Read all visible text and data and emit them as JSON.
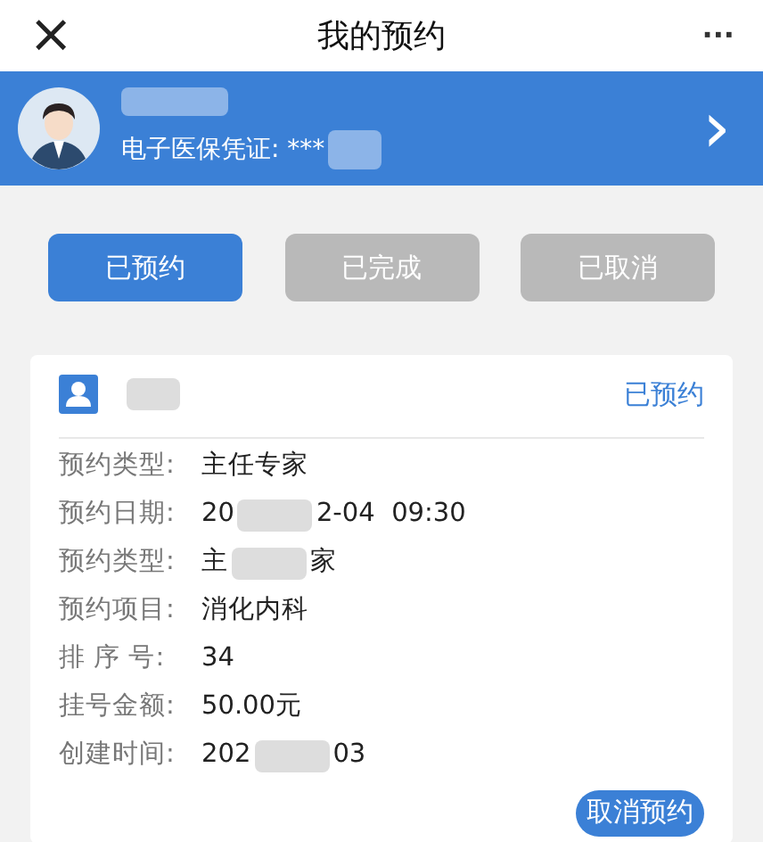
{
  "nav_bar": {
    "close": "×",
    "title": "我的预约",
    "more": "···"
  },
  "profile": {
    "card_label": "电子医保凭证: ***",
    "chevron": "›"
  },
  "tabs": [
    {
      "label": "已预约",
      "selected": true
    },
    {
      "label": "已完成",
      "selected": false
    },
    {
      "label": "已取消",
      "selected": false
    }
  ],
  "appointment": {
    "status": "已预约",
    "fields": [
      {
        "label": "预约类型:",
        "value": "主任专家"
      },
      {
        "label": "预约日期:",
        "value": "20",
        "value_end": "2-04  09:30"
      },
      {
        "label": "预约类型:",
        "value": "主",
        "value_end": "家"
      },
      {
        "label": "预约项目:",
        "value": "消化内科"
      },
      {
        "label": "排 序 号:",
        "value": "34"
      },
      {
        "label": "挂号金额:",
        "value": "50.00元"
      },
      {
        "label": "创建时间:",
        "value": "202",
        "value_end": "03"
      }
    ],
    "cancel_button": "取消预约"
  }
}
